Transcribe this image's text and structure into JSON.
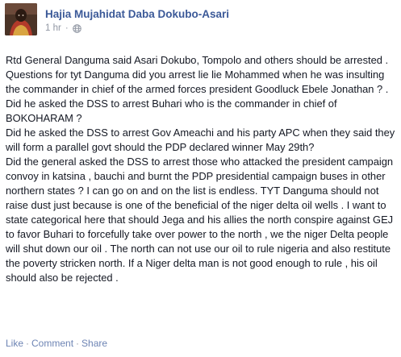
{
  "post": {
    "author": "Hajia Mujahidat Daba Dokubo-Asari",
    "timestamp": "1 hr",
    "separator": "·",
    "privacy_icon": "globe-icon",
    "paragraphs": [
      "Rtd General Danguma said Asari Dokubo, Tompolo and others should be arrested . Questions for tyt Danguma did you arrest lie lie Mohammed when he was insulting the commander in chief of the armed forces president Goodluck Ebele Jonathan ? .",
      "Did he asked the DSS to arrest Buhari who is the commander in chief of BOKOHARAM ?",
      "Did he asked the DSS to arrest Gov Ameachi and his party APC when they said they will form a parallel govt should the PDP declared winner May 29th?",
      "Did the general asked the DSS to arrest those who attacked the president campaign convoy in katsina , bauchi and burnt the PDP presidential campaign buses in other northern states ? I can go on and on the list is endless. TYT Danguma should not raise dust just because is one of the beneficial of the niger delta oil wells . I want to state categorical here that should Jega and his allies the north conspire against GEJ to favor Buhari to forcefully take over power to the north , we the niger Delta people will shut down our oil . The north can not use our oil to rule nigeria and also restitute the poverty stricken north. If a Niger delta man is not good enough to rule , his oil should also be rejected ."
    ]
  },
  "actions": {
    "like_label": "Like",
    "comment_label": "Comment",
    "share_label": "Share",
    "separator": "·"
  },
  "colors": {
    "author_link": "#3b5998",
    "action_link": "#6d84b4",
    "meta_text": "#9197a3",
    "body_text": "#141823"
  }
}
